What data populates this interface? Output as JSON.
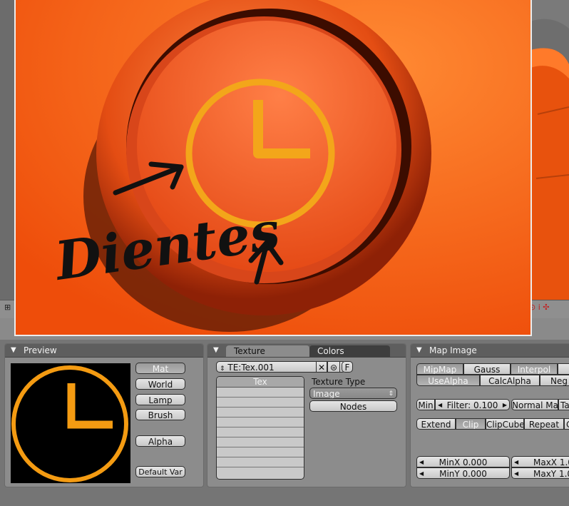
{
  "render": {
    "annotation_text": "Dientes"
  },
  "preview_panel": {
    "title": "Preview",
    "buttons": [
      "Mat",
      "World",
      "Lamp",
      "Brush"
    ],
    "selected": "Mat",
    "alpha_label": "Alpha",
    "default_vars_label": "Default Var"
  },
  "texture_panel": {
    "tabs": [
      "Texture",
      "Colors"
    ],
    "active_tab": "Texture",
    "texture_name": "TE:Tex.001",
    "f_label": "F",
    "tex_list_header": "Tex",
    "texture_type_label": "Texture Type",
    "texture_type_value": "Image",
    "nodes_label": "Nodes"
  },
  "map_image_panel": {
    "title": "Map Image",
    "row1": [
      "MipMap",
      "Gauss",
      "Interpol"
    ],
    "row2": [
      "UseAlpha",
      "CalcAlpha",
      "Neg"
    ],
    "min_label": "Min",
    "filter_label": "Filter: 0.100",
    "normal_map_label": "Normal Ma",
    "ta_label": "Ta",
    "extend_row": [
      "Extend",
      "Clip",
      "ClipCube",
      "Repeat",
      "C"
    ],
    "extend_selected": "Clip",
    "minx": "MinX 0.000",
    "maxx": "MaxX 1.0",
    "miny": "MinY 0.000",
    "maxy": "MaxY 1.0"
  },
  "colors": {
    "orange": "#f0580f",
    "clock_gold": "#f3a61a",
    "preview_clock": "#f49b12",
    "panel_bg": "#8c8c8c",
    "panel_header": "#5e5e5e"
  }
}
